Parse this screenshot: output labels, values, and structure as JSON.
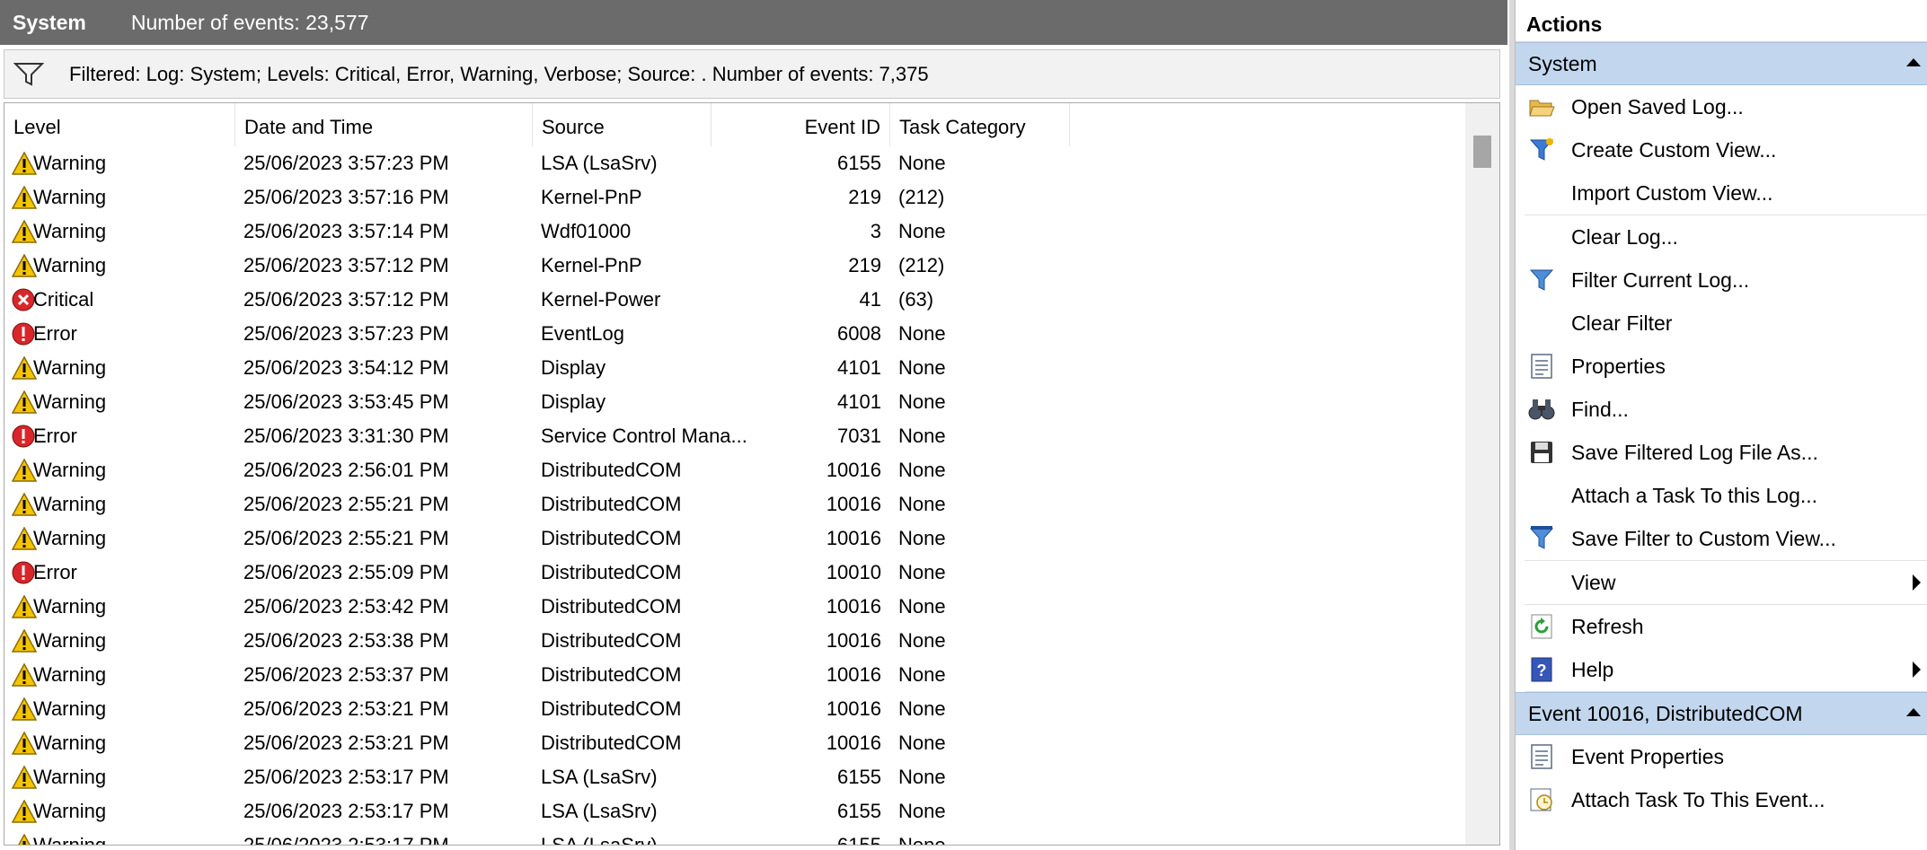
{
  "header": {
    "log_name": "System",
    "event_count": "Number of events: 23,577",
    "filter_text": "Filtered: Log: System; Levels: Critical, Error, Warning, Verbose; Source: . Number of events: 7,375"
  },
  "columns": {
    "level": "Level",
    "date": "Date and Time",
    "source": "Source",
    "event_id": "Event ID",
    "task_category": "Task Category"
  },
  "events": [
    {
      "icon": "warning-icon",
      "level": "Warning",
      "date": "25/06/2023 3:57:23 PM",
      "source": "LSA (LsaSrv)",
      "id": "6155",
      "category": "None"
    },
    {
      "icon": "warning-icon",
      "level": "Warning",
      "date": "25/06/2023 3:57:16 PM",
      "source": "Kernel-PnP",
      "id": "219",
      "category": "(212)"
    },
    {
      "icon": "warning-icon",
      "level": "Warning",
      "date": "25/06/2023 3:57:14 PM",
      "source": "Wdf01000",
      "id": "3",
      "category": "None"
    },
    {
      "icon": "warning-icon",
      "level": "Warning",
      "date": "25/06/2023 3:57:12 PM",
      "source": "Kernel-PnP",
      "id": "219",
      "category": "(212)"
    },
    {
      "icon": "critical-icon",
      "level": "Critical",
      "date": "25/06/2023 3:57:12 PM",
      "source": "Kernel-Power",
      "id": "41",
      "category": "(63)"
    },
    {
      "icon": "error-icon",
      "level": "Error",
      "date": "25/06/2023 3:57:23 PM",
      "source": "EventLog",
      "id": "6008",
      "category": "None"
    },
    {
      "icon": "warning-icon",
      "level": "Warning",
      "date": "25/06/2023 3:54:12 PM",
      "source": "Display",
      "id": "4101",
      "category": "None"
    },
    {
      "icon": "warning-icon",
      "level": "Warning",
      "date": "25/06/2023 3:53:45 PM",
      "source": "Display",
      "id": "4101",
      "category": "None"
    },
    {
      "icon": "error-icon",
      "level": "Error",
      "date": "25/06/2023 3:31:30 PM",
      "source": "Service Control Mana...",
      "id": "7031",
      "category": "None"
    },
    {
      "icon": "warning-icon",
      "level": "Warning",
      "date": "25/06/2023 2:56:01 PM",
      "source": "DistributedCOM",
      "id": "10016",
      "category": "None"
    },
    {
      "icon": "warning-icon",
      "level": "Warning",
      "date": "25/06/2023 2:55:21 PM",
      "source": "DistributedCOM",
      "id": "10016",
      "category": "None"
    },
    {
      "icon": "warning-icon",
      "level": "Warning",
      "date": "25/06/2023 2:55:21 PM",
      "source": "DistributedCOM",
      "id": "10016",
      "category": "None"
    },
    {
      "icon": "error-icon",
      "level": "Error",
      "date": "25/06/2023 2:55:09 PM",
      "source": "DistributedCOM",
      "id": "10010",
      "category": "None"
    },
    {
      "icon": "warning-icon",
      "level": "Warning",
      "date": "25/06/2023 2:53:42 PM",
      "source": "DistributedCOM",
      "id": "10016",
      "category": "None"
    },
    {
      "icon": "warning-icon",
      "level": "Warning",
      "date": "25/06/2023 2:53:38 PM",
      "source": "DistributedCOM",
      "id": "10016",
      "category": "None"
    },
    {
      "icon": "warning-icon",
      "level": "Warning",
      "date": "25/06/2023 2:53:37 PM",
      "source": "DistributedCOM",
      "id": "10016",
      "category": "None"
    },
    {
      "icon": "warning-icon",
      "level": "Warning",
      "date": "25/06/2023 2:53:21 PM",
      "source": "DistributedCOM",
      "id": "10016",
      "category": "None"
    },
    {
      "icon": "warning-icon",
      "level": "Warning",
      "date": "25/06/2023 2:53:21 PM",
      "source": "DistributedCOM",
      "id": "10016",
      "category": "None"
    },
    {
      "icon": "warning-icon",
      "level": "Warning",
      "date": "25/06/2023 2:53:17 PM",
      "source": "LSA (LsaSrv)",
      "id": "6155",
      "category": "None"
    },
    {
      "icon": "warning-icon",
      "level": "Warning",
      "date": "25/06/2023 2:53:17 PM",
      "source": "LSA (LsaSrv)",
      "id": "6155",
      "category": "None"
    },
    {
      "icon": "warning-icon",
      "level": "Warning",
      "date": "25/06/2023 2:53:17 PM",
      "source": "LSA (LsaSrv)",
      "id": "6155",
      "category": "None"
    }
  ],
  "actions": {
    "title": "Actions",
    "system_section": "System",
    "system_items": [
      {
        "icon": "open-folder-icon",
        "label": "Open Saved Log..."
      },
      {
        "icon": "create-filter-icon",
        "label": "Create Custom View..."
      },
      {
        "icon": "",
        "label": "Import Custom View..."
      },
      {
        "icon": "",
        "label": "Clear Log..."
      },
      {
        "icon": "filter-icon",
        "label": "Filter Current Log..."
      },
      {
        "icon": "",
        "label": "Clear Filter"
      },
      {
        "icon": "properties-icon",
        "label": "Properties"
      },
      {
        "icon": "binoculars-icon",
        "label": "Find..."
      },
      {
        "icon": "save-disk-icon",
        "label": "Save Filtered Log File As..."
      },
      {
        "icon": "",
        "label": "Attach a Task To this Log..."
      },
      {
        "icon": "save-filter-icon",
        "label": "Save Filter to Custom View..."
      },
      {
        "icon": "",
        "label": "View",
        "submenu": true
      },
      {
        "icon": "refresh-icon",
        "label": "Refresh"
      },
      {
        "icon": "help-icon",
        "label": "Help",
        "submenu": true
      }
    ],
    "event_section": "Event 10016, DistributedCOM",
    "event_items": [
      {
        "icon": "properties-icon",
        "label": "Event Properties"
      },
      {
        "icon": "attach-task-icon",
        "label": "Attach Task To This Event..."
      }
    ]
  },
  "colors": {
    "titlebar": "#6b6b6b",
    "section_bg": "#c2d7ee",
    "warning": "#f5c400",
    "error": "#d9262b"
  }
}
